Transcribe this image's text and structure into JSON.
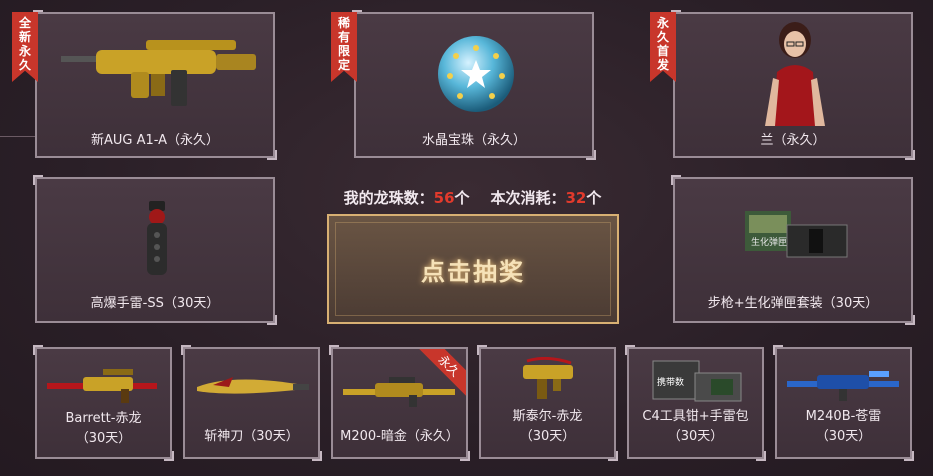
{
  "stats": {
    "my_label": "我的龙珠数：",
    "my_count": "56",
    "my_unit": "个",
    "cost_label": "本次消耗：",
    "cost_count": "32",
    "cost_unit": "个"
  },
  "draw_button": {
    "label": "点击抽奖"
  },
  "top_items": [
    {
      "name": "新AUG A1-A（永久）",
      "ribbon": [
        "全",
        "新",
        "永",
        "久"
      ]
    },
    {
      "name": "水晶宝珠（永久）",
      "ribbon": [
        "稀",
        "有",
        "限",
        "定"
      ]
    },
    {
      "name": "兰（永久）",
      "ribbon": [
        "永",
        "久",
        "首",
        "发"
      ]
    }
  ],
  "mid_items": [
    {
      "name": "高爆手雷-SS（30天）"
    },
    {
      "name": "步枪+生化弹匣套装（30天）",
      "art_text": "生化弹匣"
    }
  ],
  "bottom_items": [
    {
      "name": "Barrett-赤龙",
      "duration": "（30天）"
    },
    {
      "name": "斩神刀（30天）"
    },
    {
      "name": "M200-暗金（永久）",
      "tag": "永久"
    },
    {
      "name": "斯泰尔-赤龙",
      "duration": "（30天）"
    },
    {
      "name": "C4工具钳+手雷包",
      "duration": "（30天）",
      "art_text": "携带数"
    },
    {
      "name": "M240B-苍雷",
      "duration": "（30天）"
    }
  ],
  "colors": {
    "accent_red": "#c8362b",
    "gold": "#d8b073",
    "number_red": "#e23a2c"
  }
}
